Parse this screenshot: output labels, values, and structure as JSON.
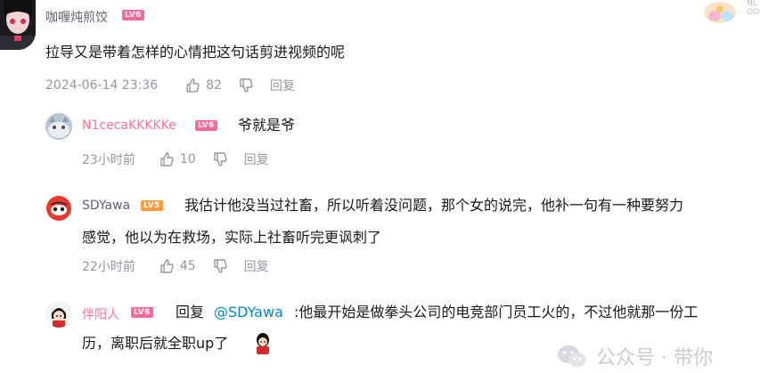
{
  "comments": [
    {
      "username": "咖喱炖煎饺",
      "level": "LV6",
      "text": "拉导又是带着怎样的心情把这句话剪进视频的呢",
      "time": "2024-06-14 23:36",
      "likes": "82",
      "reply_label": "回复"
    }
  ],
  "replies": [
    {
      "username": "N1cecaKKKKKe",
      "level": "LV6",
      "text": "爷就是爷",
      "time": "23小时前",
      "likes": "10",
      "reply_label": "回复"
    },
    {
      "username": "SDYawa",
      "level": "LV5",
      "text_line1": "我估计他没当过社畜，所以听着没问题，那个女的说完，他补一句有一种要努力",
      "text_line2": "感觉，他以为在救场，实际上社畜听完更讽刺了",
      "time": "22小时前",
      "likes": "45",
      "reply_label": "回复"
    },
    {
      "username": "伴阳人",
      "level": "LV6",
      "reply_prefix": "回复",
      "mention": "@SDYawa",
      "text_line1": ":他最开始是做拳头公司的电竞部门员工火的，不过他就那一份工",
      "text_line2": "历，离职后就全职up了"
    }
  ],
  "watermark": {
    "text": "公众号 · 带你"
  },
  "corner_badge_text": "NL\nOO",
  "colors": {
    "accent_pink": "#fb7299",
    "level_pink": "#ff6699",
    "level_orange": "#ff9b3c",
    "link_blue": "#008ac5",
    "meta_gray": "#9499a0"
  },
  "icons": [
    "like-icon",
    "dislike-icon",
    "wechat-icon",
    "sticker-emoji"
  ]
}
